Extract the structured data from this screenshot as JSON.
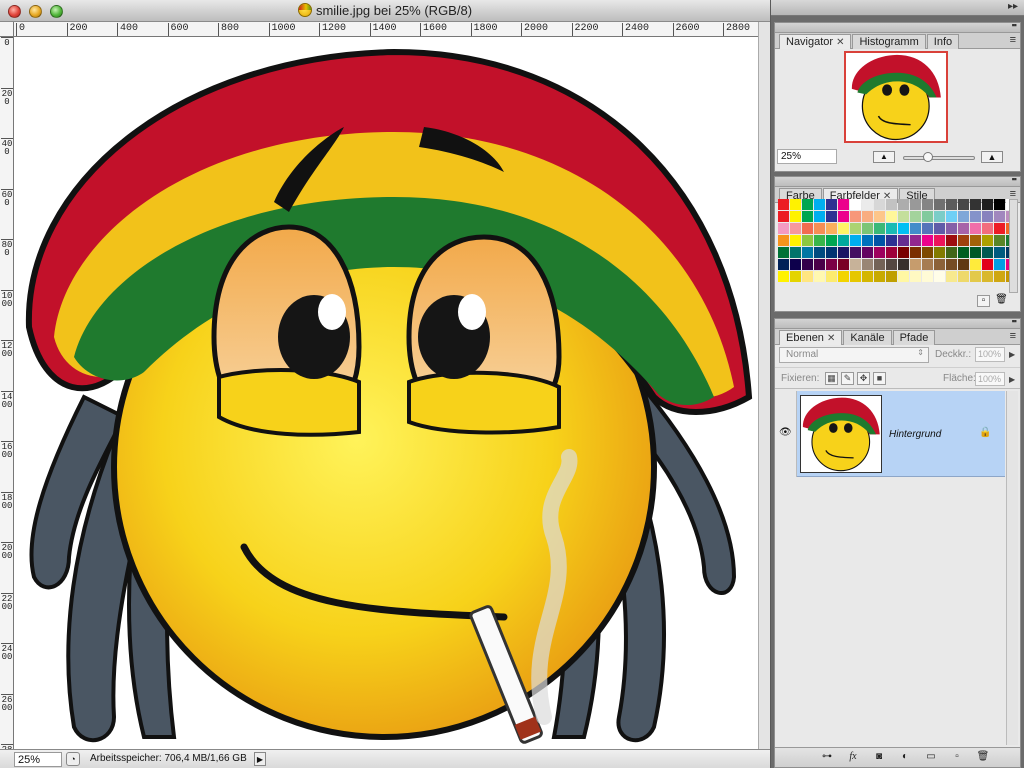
{
  "document": {
    "title": "smilie.jpg bei 25% (RGB/8)",
    "zoom": "25%",
    "memory": "Arbeitsspeicher: 706,4 MB/1,66 GB",
    "ruler_top_ticks": [
      "0",
      "200",
      "400",
      "600",
      "800",
      "1000",
      "1200",
      "1400",
      "1600",
      "1800",
      "2000",
      "2200",
      "2400",
      "2600",
      "2800"
    ],
    "ruler_left_ticks": [
      "0",
      "200",
      "400",
      "600",
      "800",
      "1000",
      "1200",
      "1400",
      "1600",
      "1800",
      "2000",
      "2200",
      "2400",
      "2600",
      "2800"
    ]
  },
  "navigator": {
    "tabs": [
      "Navigator",
      "Histogramm",
      "Info"
    ],
    "zoom": "25%",
    "zoom_level": 0.25,
    "frame_color": "#d9413a"
  },
  "swatches": {
    "tabs": [
      "Farbe",
      "Farbfelder",
      "Stile"
    ],
    "colors": [
      "#ec1c24",
      "#fff200",
      "#00a651",
      "#00aeef",
      "#2e3192",
      "#ec008c",
      "#ffffff",
      "#ebebeb",
      "#d7d7d7",
      "#c2c2c2",
      "#adadad",
      "#999999",
      "#858585",
      "#707070",
      "#5c5c5c",
      "#474747",
      "#333333",
      "#1f1f1f",
      "#000000",
      "#ffffff",
      "#ec1c24",
      "#fff200",
      "#00a651",
      "#00aeef",
      "#2e3192",
      "#ec008c",
      "#f7977a",
      "#f9ad81",
      "#fdc68a",
      "#fff79a",
      "#c4df9b",
      "#a3d39c",
      "#82ca9d",
      "#7bcdc8",
      "#6ecff6",
      "#7ea7d8",
      "#8493ca",
      "#8882be",
      "#a187be",
      "#bc8dbf",
      "#f49ac2",
      "#f6989d",
      "#f26c4f",
      "#f68e55",
      "#fbaf5c",
      "#fff467",
      "#acd372",
      "#7cc576",
      "#3bb878",
      "#1abbb4",
      "#00bff3",
      "#438cca",
      "#5574b9",
      "#605ca8",
      "#855fa8",
      "#a763a8",
      "#f06ea9",
      "#f26d7d",
      "#ed1c24",
      "#f26522",
      "#f7941d",
      "#fff200",
      "#8dc73f",
      "#39b54a",
      "#00a651",
      "#00a99d",
      "#00aeef",
      "#0072bc",
      "#0054a6",
      "#2e3192",
      "#662d91",
      "#92278f",
      "#ec008c",
      "#ed145b",
      "#9e0b0f",
      "#a0410d",
      "#a36209",
      "#aba000",
      "#598527",
      "#197b30",
      "#007236",
      "#00746b",
      "#0076a3",
      "#004b80",
      "#003471",
      "#1b1464",
      "#440e62",
      "#630460",
      "#9e005d",
      "#9e0039",
      "#790000",
      "#7b2e00",
      "#7d4900",
      "#827b00",
      "#406618",
      "#005e20",
      "#005826",
      "#005952",
      "#005b7f",
      "#003663",
      "#002157",
      "#0d004c",
      "#32004b",
      "#4b0049",
      "#7b0046",
      "#7a0026",
      "#c7b299",
      "#998675",
      "#736357",
      "#534741",
      "#37302d",
      "#c69c6d",
      "#a67c52",
      "#8c6239",
      "#754c24",
      "#603913",
      "#ffeb3b",
      "#e2001a",
      "#009fe3",
      "#e6007e",
      "#fff200",
      "#e4d400",
      "#ffe680",
      "#fff8b0",
      "#fceb6e",
      "#f2d400",
      "#e6c700",
      "#d4b600",
      "#c8aa00",
      "#bf9f00",
      "#fff7a3",
      "#fff9c2",
      "#fffbd6",
      "#fffde8",
      "#f7e98e",
      "#eed96b",
      "#e3c94a",
      "#d9b82c",
      "#cfa712",
      "#c49600"
    ]
  },
  "layers": {
    "tabs": [
      "Ebenen",
      "Kanäle",
      "Pfade"
    ],
    "blend_mode": "Normal",
    "opacity_label": "Deckkr.:",
    "opacity": "100%",
    "lock_label": "Fixieren:",
    "fill_label": "Fläche:",
    "fill": "100%",
    "layer_name": "Hintergrund"
  },
  "icons": {
    "eye": "eye-icon",
    "lock": "lock-icon",
    "link": "link-icon",
    "fx": "fx",
    "mask": "mask-icon",
    "adjust": "adjustment-icon",
    "folder": "folder-icon",
    "new": "new-layer-icon",
    "trash": "trash-icon"
  }
}
